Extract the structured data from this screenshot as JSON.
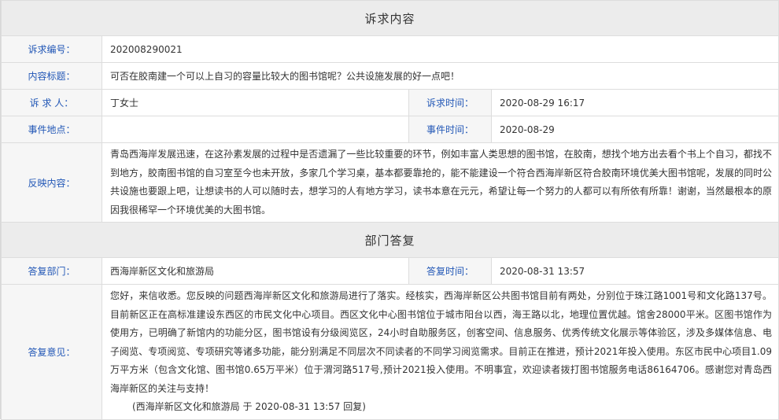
{
  "section_complaint": "诉求内容",
  "complaint": {
    "id_label": "诉求编号：",
    "id_value": "202008290021",
    "title_label": "内容标题：",
    "title_value": "可否在胶南建一个可以上自习的容量比较大的图书馆呢？公共设施发展的好一点吧！",
    "person_label": "诉 求 人：",
    "person_value": "丁女士",
    "time_label": "诉求时间：",
    "time_value": "2020-08-29 16:17",
    "place_label": "事件地点：",
    "place_value": "",
    "event_time_label": "事件时间：",
    "event_time_value": "2020-08-29",
    "content_label": "反映内容：",
    "content_value": "青岛西海岸发展迅速，在这孙素发展的过程中是否遗漏了一些比较重要的环节，例如丰富人类思想的图书馆，在胶南，想找个地方出去看个书上个自习，都找不到地方，胶南图书馆的自习室至今也未开放，多家几个学习桌，基本都要靠抢的，能不能建设一个符合西海岸新区符合胶南环境优美大图书馆呢，发展的同时公共设施也要跟上吧，让想读书的人可以随时去，想学习的人有地方学习，读书本意在元元，希望让每一个努力的人都可以有所依有所靠！谢谢，当然最根本的原因我很稀罕一个环境优美的大图书馆。"
  },
  "section_reply": "部门答复",
  "reply": {
    "dept_label": "答复部门：",
    "dept_value": "西海岸新区文化和旅游局",
    "time_label": "答复时间：",
    "time_value": "2020-08-31 13:57",
    "opinion_label": "答复意见：",
    "opinion_value": "您好，来信收悉。您反映的问题西海岸新区文化和旅游局进行了落实。经核实，西海岸新区公共图书馆目前有两处，分别位于珠江路1001号和文化路137号。目前新区正在高标准建设东西区的市民文化中心项目。西区文化中心图书馆位于城市阳台以西，海王路以北，地理位置优越。馆舍28000平米。区图书馆作为使用方，已明确了新馆内的功能分区，图书馆设有分级阅览区，24小时自助服务区，创客空间、信息服务、优秀传统文化展示等体验区，涉及多媒体信息、电子阅览、专项阅览、专项研究等诸多功能，能分别满足不同层次不同读者的不同学习阅览需求。目前正在推进，预计2021年投入使用。东区市民中心项目1.09万平方米（包含文化馆、图书馆0.65万平米）位于渭河路517号,预计2021投入使用。不明事宜，欢迎读者拨打图书馆服务电话86164706。感谢您对青岛西海岸新区的关注与支持！",
    "signature": "(西海岸新区文化和旅游局 于 2020-08-31 13:57 回复)"
  }
}
